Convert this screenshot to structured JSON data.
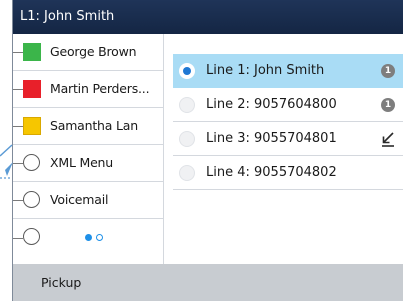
{
  "titlebar": {
    "title": "L1: John Smith"
  },
  "programmable_keys": [
    {
      "label": "George Brown",
      "indicator": "green-square",
      "color": "#3bb54a"
    },
    {
      "label": "Martin Perders...",
      "indicator": "red-square",
      "color": "#e8202a"
    },
    {
      "label": "Samantha Lan",
      "indicator": "yellow-square",
      "color": "#f6c600"
    },
    {
      "label": "XML Menu",
      "indicator": "empty-circle"
    },
    {
      "label": "Voicemail",
      "indicator": "empty-circle"
    },
    {
      "label": "",
      "indicator": "empty-circle"
    }
  ],
  "pagination": {
    "pages": 2,
    "active_page": 1
  },
  "lines": [
    {
      "label": "Line 1: John Smith",
      "selected": true,
      "badge": "1",
      "status_icon": "badge"
    },
    {
      "label": "Line 2: 9057604800",
      "selected": false,
      "badge": "1",
      "status_icon": "badge"
    },
    {
      "label": "Line 3: 9055704801",
      "selected": false,
      "status_icon": "missed-call-arrow-icon"
    },
    {
      "label": "Line 4: 9055704802",
      "selected": false
    }
  ],
  "softkeys": {
    "pickup_label": "Pickup"
  },
  "colors": {
    "title_bar": "#1a2d4f",
    "selection": "#a9dcf5",
    "accent_blue": "#1e90e8",
    "softkey_bar": "#c8ccd1",
    "callout_line": "#5b9bd5"
  }
}
